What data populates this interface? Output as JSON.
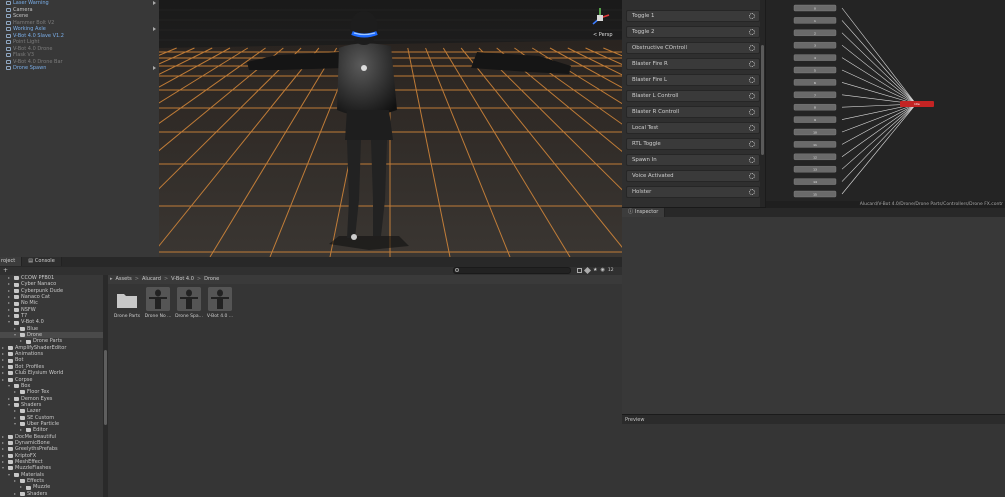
{
  "hierarchy": {
    "items": [
      {
        "label": "Laser Warning",
        "style": "blue"
      },
      {
        "label": "Camera",
        "style": "normal"
      },
      {
        "label": "Scene",
        "style": "normal"
      },
      {
        "label": "Hammer Bolt V2",
        "style": "dim"
      },
      {
        "label": "Working Axle",
        "style": "blue"
      },
      {
        "label": "V-Bot 4.0 Slave V1.2",
        "style": "blue"
      },
      {
        "label": "Point Light",
        "style": "dim"
      },
      {
        "label": "V-Bot 4.0 Drone",
        "style": "dim"
      },
      {
        "label": "Flask V3",
        "style": "dim"
      },
      {
        "label": "V-Bot 4.0 Drone Bar",
        "style": "dim"
      },
      {
        "label": "Drone Spawn",
        "style": "blue"
      }
    ]
  },
  "scene": {
    "view_label": "< Persp",
    "gizmo": {
      "x": "x",
      "y": "y",
      "z": "z"
    }
  },
  "animator": {
    "parameters": [
      "Toggle 1",
      "Toggle 2",
      "Obstructive COntroll",
      "Blaster Fire R",
      "Blaster Fire L",
      "Blaster L Controll",
      "Blaster R Controll",
      "Local Test",
      "RTL Toggle",
      "Spawn In",
      "Voice Activated",
      "Holster"
    ],
    "state_labels": [
      "0",
      "1",
      "2",
      "3",
      "4",
      "5",
      "6",
      "7",
      "8",
      "9",
      "10",
      "11",
      "12",
      "13",
      "14",
      "15"
    ],
    "target_state": "Idle",
    "path": "Alucard/V-Bot 4.0/Drone/Drone Parts/Controllers/Drone FX.contr"
  },
  "inspector": {
    "tab_label": "Inspector",
    "preview_label": "Preview"
  },
  "project": {
    "tabs": [
      "roject",
      "Console"
    ],
    "badge": "12",
    "breadcrumb": [
      "Assets",
      "Alucard",
      "V-Bot 4.0",
      "Drone"
    ],
    "tree": [
      {
        "label": "CCOW PFB01",
        "indent": 1,
        "open": false
      },
      {
        "label": "Cyber Nanaco",
        "indent": 1,
        "open": false
      },
      {
        "label": "Cyberpunk Dude",
        "indent": 1,
        "open": false
      },
      {
        "label": "Nanaco Cat",
        "indent": 1,
        "open": false
      },
      {
        "label": "No Mic",
        "indent": 1,
        "open": false
      },
      {
        "label": "NSFW",
        "indent": 1,
        "open": false
      },
      {
        "label": "T7",
        "indent": 1,
        "open": false
      },
      {
        "label": "V-Bot 4.0",
        "indent": 1,
        "open": true
      },
      {
        "label": "Blue",
        "indent": 2,
        "open": false
      },
      {
        "label": "Drone",
        "indent": 2,
        "open": true,
        "selected": true
      },
      {
        "label": "Drone Parts",
        "indent": 3,
        "open": false
      },
      {
        "label": "AmplifyShaderEditor",
        "indent": 0,
        "open": false
      },
      {
        "label": "Animations",
        "indent": 0,
        "open": false
      },
      {
        "label": "Bot",
        "indent": 0,
        "open": false
      },
      {
        "label": "Bot_Profiles",
        "indent": 0,
        "open": false
      },
      {
        "label": "Club Elysium World",
        "indent": 0,
        "open": false
      },
      {
        "label": "Corpse",
        "indent": 0,
        "open": false
      },
      {
        "label": "Box",
        "indent": 1,
        "open": true
      },
      {
        "label": "Floor Tex",
        "indent": 2,
        "open": false
      },
      {
        "label": "Demon Eyes",
        "indent": 1,
        "open": false
      },
      {
        "label": "Shaders",
        "indent": 1,
        "open": true
      },
      {
        "label": "Lazer",
        "indent": 2,
        "open": false
      },
      {
        "label": "SE Custom",
        "indent": 2,
        "open": false
      },
      {
        "label": "Uber Particle",
        "indent": 2,
        "open": true
      },
      {
        "label": "Editor",
        "indent": 3,
        "open": false
      },
      {
        "label": "DocMe Beautiful",
        "indent": 0,
        "open": false
      },
      {
        "label": "DynamicBone",
        "indent": 0,
        "open": false
      },
      {
        "label": "GreelythsPrefabs",
        "indent": 0,
        "open": false
      },
      {
        "label": "KriptoFX",
        "indent": 0,
        "open": false
      },
      {
        "label": "MeshEffect",
        "indent": 0,
        "open": false
      },
      {
        "label": "MuzzleFlashes",
        "indent": 0,
        "open": true
      },
      {
        "label": "Materials",
        "indent": 1,
        "open": true
      },
      {
        "label": "Effects",
        "indent": 2,
        "open": false
      },
      {
        "label": "Muzzle",
        "indent": 3,
        "open": false
      },
      {
        "label": "Shaders",
        "indent": 2,
        "open": false
      }
    ],
    "assets": [
      {
        "label": "Drone Parts",
        "kind": "folder"
      },
      {
        "label": "Drone No ...",
        "kind": "model"
      },
      {
        "label": "Drone Spa...",
        "kind": "model"
      },
      {
        "label": "V-Bot 4.0 ...",
        "kind": "model"
      }
    ]
  }
}
